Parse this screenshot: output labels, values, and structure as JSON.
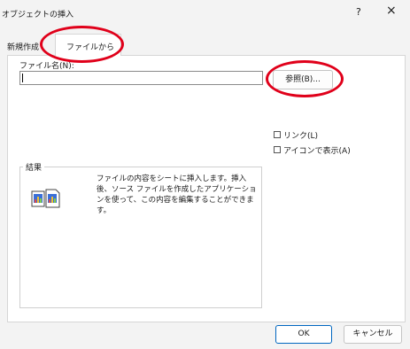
{
  "window": {
    "title": "オブジェクトの挿入",
    "help_glyph": "?",
    "close_glyph": "×"
  },
  "tabs": [
    {
      "label": "新規作成"
    },
    {
      "label": "ファイルから"
    }
  ],
  "file_name": {
    "label": "ファイル名(N):",
    "value": ""
  },
  "browse_button": {
    "label": "参照(B)..."
  },
  "options": {
    "link": {
      "label": "リンク(L)",
      "checked": false
    },
    "show_as_icon": {
      "label": "アイコンで表示(A)",
      "checked": false
    }
  },
  "result": {
    "title": "結果",
    "text": "ファイルの内容をシートに挿入します。挿入後、ソース ファイルを作成したアプリケーションを使って、この内容を編集することができます。"
  },
  "buttons": {
    "ok": "OK",
    "cancel": "キャンセル"
  },
  "colors": {
    "highlight_ring": "#e0001a",
    "accent": "#0067c0"
  }
}
